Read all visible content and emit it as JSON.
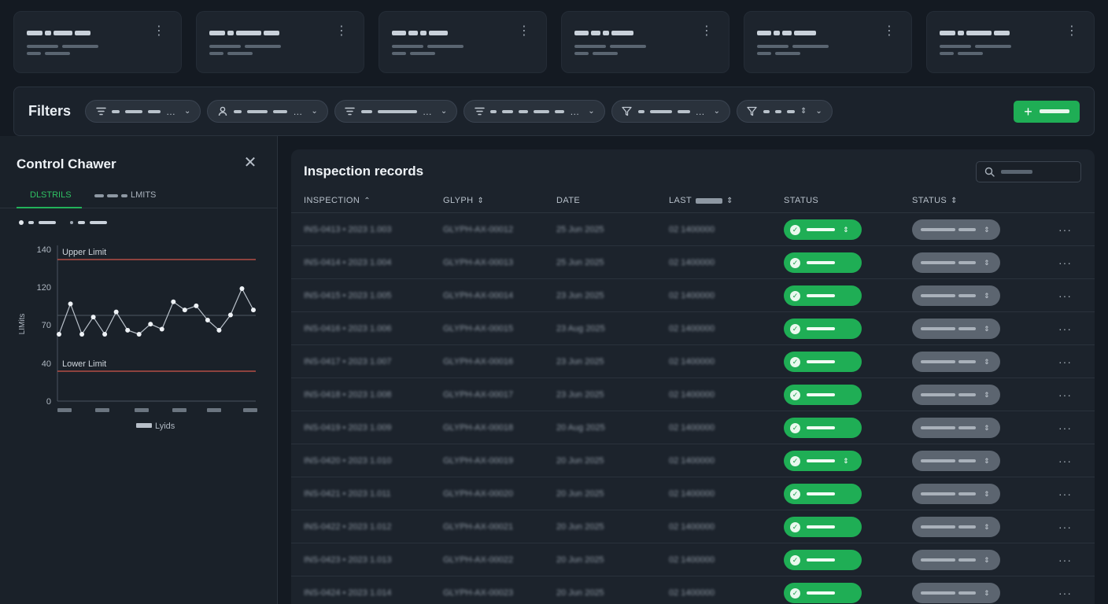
{
  "filters": {
    "title": "Filters"
  },
  "drawer": {
    "title": "Control Chawer",
    "tab_active": "DLSTRILS",
    "tab_inactive": "LMITS"
  },
  "chart_data": {
    "type": "line",
    "title": "",
    "xlabel": "Lyids",
    "ylabel": "LIMits",
    "yticks": [
      0,
      40,
      70,
      120,
      140
    ],
    "ylim": [
      0,
      140
    ],
    "x": [
      1,
      2,
      3,
      4,
      5,
      6,
      7,
      8,
      9,
      10,
      11,
      12,
      13,
      14,
      15,
      16,
      17,
      18
    ],
    "series": [
      {
        "values": [
          58,
          88,
          58,
          75,
          58,
          80,
          62,
          58,
          68,
          63,
          90,
          82,
          86,
          72,
          62,
          77,
          103,
          82
        ]
      }
    ],
    "reference_lines": [
      {
        "label": "Upper Limit",
        "value": 118,
        "color": "#d2564b"
      },
      {
        "label": "Lower Limit",
        "value": 32,
        "color": "#d2564b"
      }
    ],
    "center_line": 75,
    "grid": false
  },
  "table": {
    "title": "Inspection records",
    "columns": [
      "INSPECTION",
      "GLYPH",
      "DATE",
      "LAST",
      "STATUS",
      "STATUS"
    ],
    "rows": [
      {
        "inspection": "INS-0413 • 2023 1.003",
        "glyph": "GLYPH-AX-00012",
        "date": "25 Jun 2025",
        "last": "02 1400000"
      },
      {
        "inspection": "INS-0414 • 2023 1.004",
        "glyph": "GLYPH-AX-00013",
        "date": "25 Jun 2025",
        "last": "02 1400000"
      },
      {
        "inspection": "INS-0415 • 2023 1.005",
        "glyph": "GLYPH-AX-00014",
        "date": "23 Jun 2025",
        "last": "02 1400000"
      },
      {
        "inspection": "INS-0416 • 2023 1.006",
        "glyph": "GLYPH-AX-00015",
        "date": "23 Aug 2025",
        "last": "02 1400000"
      },
      {
        "inspection": "INS-0417 • 2023 1.007",
        "glyph": "GLYPH-AX-00016",
        "date": "23 Jun 2025",
        "last": "02 1400000"
      },
      {
        "inspection": "INS-0418 • 2023 1.008",
        "glyph": "GLYPH-AX-00017",
        "date": "23 Jun 2025",
        "last": "02 1400000"
      },
      {
        "inspection": "INS-0419 • 2023 1.009",
        "glyph": "GLYPH-AX-00018",
        "date": "20 Aug 2025",
        "last": "02 1400000"
      },
      {
        "inspection": "INS-0420 • 2023 1.010",
        "glyph": "GLYPH-AX-00019",
        "date": "20 Jun 2025",
        "last": "02 1400000"
      },
      {
        "inspection": "INS-0421 • 2023 1.011",
        "glyph": "GLYPH-AX-00020",
        "date": "20 Jun 2025",
        "last": "02 1400000"
      },
      {
        "inspection": "INS-0422 • 2023 1.012",
        "glyph": "GLYPH-AX-00021",
        "date": "20 Jun 2025",
        "last": "02 1400000"
      },
      {
        "inspection": "INS-0423 • 2023 1.013",
        "glyph": "GLYPH-AX-00022",
        "date": "20 Jun 2025",
        "last": "02 1400000"
      },
      {
        "inspection": "INS-0424 • 2023 1.014",
        "glyph": "GLYPH-AX-00023",
        "date": "20 Jun 2025",
        "last": "02 1400000"
      }
    ]
  },
  "colors": {
    "accent_green": "#1fae55",
    "limit_red": "#d2564b",
    "status_gray": "#5c6570"
  },
  "icons": [
    "kebab-icon",
    "filter-icon",
    "user-icon",
    "funnel-icon",
    "sort-icon",
    "chevron-down-icon",
    "plus-icon",
    "close-icon",
    "search-icon",
    "check-icon"
  ]
}
